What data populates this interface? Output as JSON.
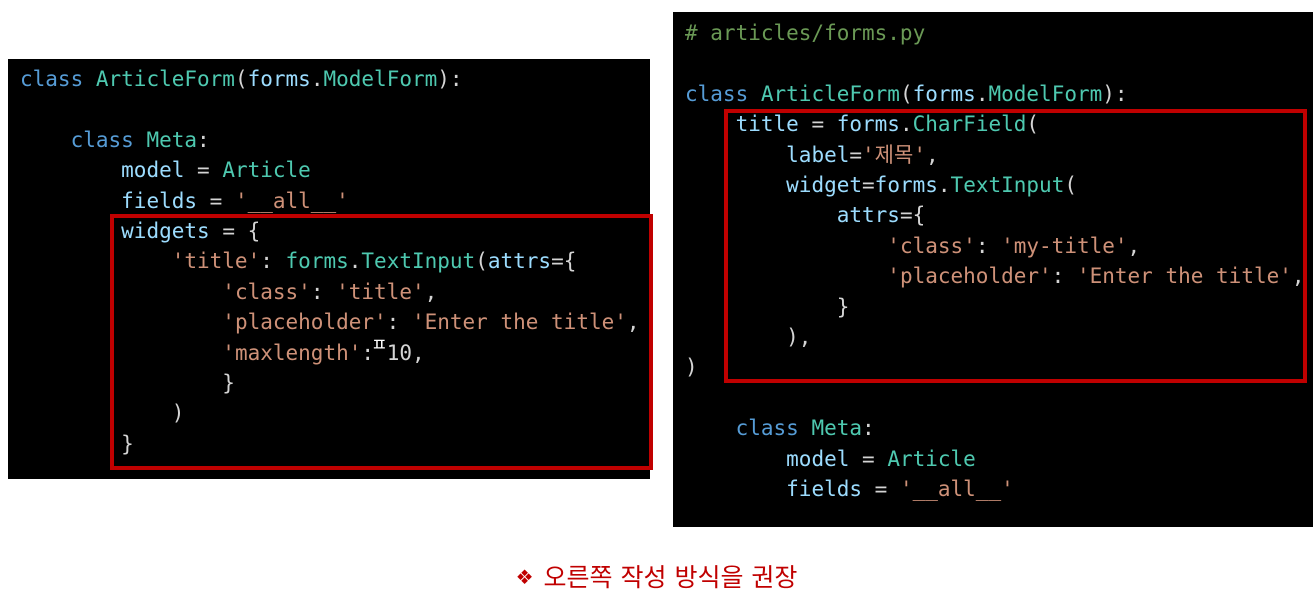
{
  "left_code": {
    "l1": [
      "class",
      "ArticleForm",
      "(",
      "forms",
      ".",
      "ModelForm",
      "):"
    ],
    "l3": [
      "class",
      "Meta",
      ":"
    ],
    "l4": [
      "model",
      " = ",
      "Article"
    ],
    "l5": [
      "fields",
      " = ",
      "'__all__'"
    ],
    "l6": [
      "widgets",
      " = {"
    ],
    "l7": [
      "'title'",
      ": ",
      "forms",
      ".",
      "TextInput",
      "(",
      "attrs",
      "={"
    ],
    "l8": [
      "'class'",
      ": ",
      "'title'",
      ","
    ],
    "l9": [
      "'placeholder'",
      ": ",
      "'Enter the title'",
      ","
    ],
    "l10": [
      "'maxlength'",
      ":",
      "10",
      ","
    ],
    "l11": "}",
    "l12": ")",
    "l13": "}"
  },
  "cursor_glyph": "ㅍ",
  "right_code": {
    "comment": "# articles/forms.py",
    "l1": [
      "class",
      "ArticleForm",
      "(",
      "forms",
      ".",
      "ModelForm",
      "):"
    ],
    "l2": [
      "title",
      " = ",
      "forms",
      ".",
      "CharField",
      "("
    ],
    "l3": [
      "label",
      "=",
      "'제목'",
      ","
    ],
    "l4": [
      "widget",
      "=",
      "forms",
      ".",
      "TextInput",
      "("
    ],
    "l5": [
      "attrs",
      "={"
    ],
    "l6": [
      "'class'",
      ": ",
      "'my-title'",
      ","
    ],
    "l7": [
      "'placeholder'",
      ": ",
      "'Enter the title'",
      ","
    ],
    "l8": "}",
    "l9": "),",
    "l10": ")",
    "l11": [
      "class",
      "Meta",
      ":"
    ],
    "l12": [
      "model",
      " = ",
      "Article"
    ],
    "l13": [
      "fields",
      " = ",
      "'__all__'"
    ]
  },
  "caption": {
    "bullet": "❖",
    "text": "오른쪽 작성 방식을 권장"
  },
  "colors": {
    "highlight": "#c00000",
    "caption": "#c00000",
    "panel_bg": "#000000"
  }
}
